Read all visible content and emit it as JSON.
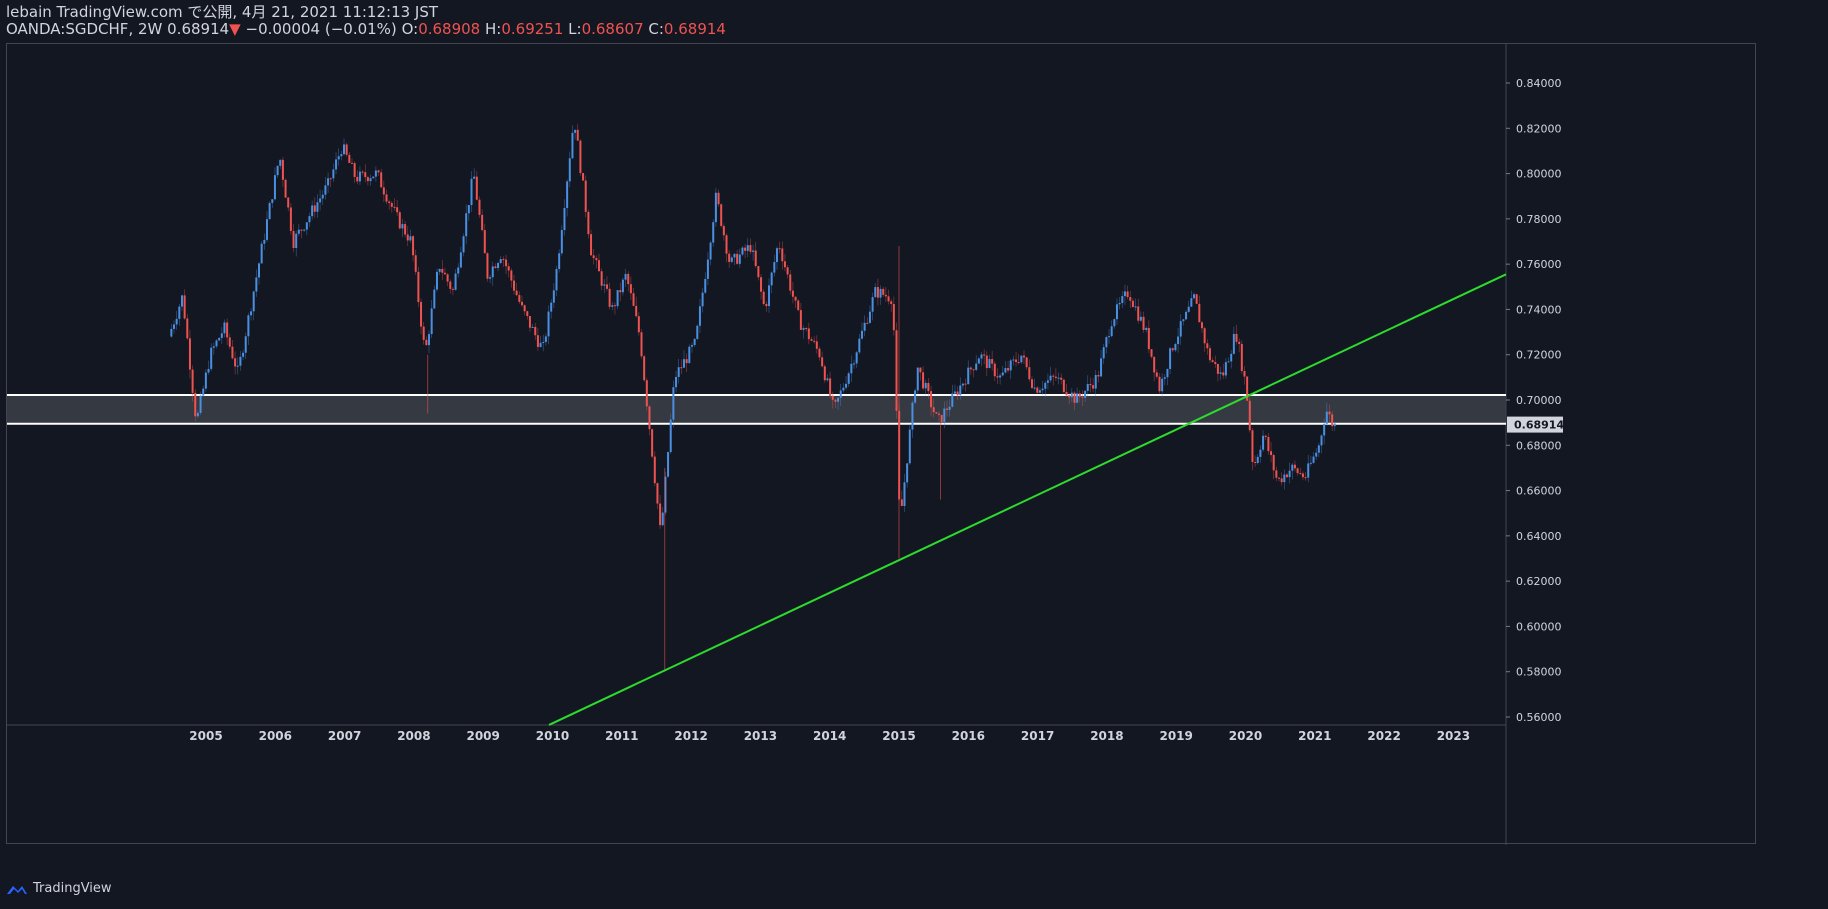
{
  "header": {
    "published_line": "lebain TradingView.com で公開, 4月 21, 2021 11:12:13 JST",
    "symbol_interval": "OANDA:SGDCHF, 2W",
    "last_price": "0.68914",
    "change_arrow": "▼",
    "change": "−0.00004 (−0.01%)",
    "o_label": "O:",
    "o_value": "0.68908",
    "h_label": "H:",
    "h_value": "0.69251",
    "l_label": "L:",
    "l_value": "0.68607",
    "c_label": "C:",
    "c_value": "0.68914"
  },
  "footer": {
    "brand": "TradingView",
    "logo_icon": "tradingview-logo-icon"
  },
  "chart_data": {
    "type": "candlestick",
    "interval": "2W",
    "symbol": "OANDA:SGDCHF",
    "xlim": [
      2004.0,
      2023.8
    ],
    "ylim": [
      0.555,
      0.858
    ],
    "y_ticks": [
      "0.56000",
      "0.58000",
      "0.60000",
      "0.62000",
      "0.64000",
      "0.66000",
      "0.68000",
      "0.70000",
      "0.72000",
      "0.74000",
      "0.76000",
      "0.78000",
      "0.80000",
      "0.82000",
      "0.84000"
    ],
    "x_ticks": [
      "2005",
      "2006",
      "2007",
      "2008",
      "2009",
      "2010",
      "2011",
      "2012",
      "2013",
      "2014",
      "2015",
      "2016",
      "2017",
      "2018",
      "2019",
      "2020",
      "2021",
      "2022",
      "2023"
    ],
    "current_price_label": "0.68914",
    "colors": {
      "background": "#131722",
      "up": "#4a90e2",
      "down": "#ef5350",
      "trendline": "#2cdc2c",
      "zone_fill": "#3a3d46",
      "zone_line": "#ffffff",
      "grid_text": "#d1d4dc"
    },
    "series": [
      {
        "name": "SGDCHF",
        "price_path": [
          [
            2004.5,
            0.728
          ],
          [
            2004.7,
            0.746
          ],
          [
            2004.9,
            0.69
          ],
          [
            2005.1,
            0.72
          ],
          [
            2005.3,
            0.732
          ],
          [
            2005.5,
            0.712
          ],
          [
            2005.8,
            0.76
          ],
          [
            2006.1,
            0.808
          ],
          [
            2006.3,
            0.77
          ],
          [
            2006.5,
            0.78
          ],
          [
            2006.8,
            0.795
          ],
          [
            2007.0,
            0.812
          ],
          [
            2007.2,
            0.798
          ],
          [
            2007.5,
            0.8
          ],
          [
            2007.8,
            0.78
          ],
          [
            2008.0,
            0.77
          ],
          [
            2008.2,
            0.72
          ],
          [
            2008.4,
            0.76
          ],
          [
            2008.6,
            0.748
          ],
          [
            2008.9,
            0.8
          ],
          [
            2009.1,
            0.755
          ],
          [
            2009.3,
            0.765
          ],
          [
            2009.6,
            0.74
          ],
          [
            2009.9,
            0.722
          ],
          [
            2010.1,
            0.758
          ],
          [
            2010.35,
            0.825
          ],
          [
            2010.6,
            0.765
          ],
          [
            2010.9,
            0.74
          ],
          [
            2011.1,
            0.755
          ],
          [
            2011.3,
            0.728
          ],
          [
            2011.5,
            0.67
          ],
          [
            2011.6,
            0.64
          ],
          [
            2011.8,
            0.71
          ],
          [
            2012.1,
            0.725
          ],
          [
            2012.4,
            0.79
          ],
          [
            2012.6,
            0.76
          ],
          [
            2012.9,
            0.768
          ],
          [
            2013.1,
            0.74
          ],
          [
            2013.3,
            0.77
          ],
          [
            2013.6,
            0.735
          ],
          [
            2013.9,
            0.72
          ],
          [
            2014.1,
            0.695
          ],
          [
            2014.4,
            0.72
          ],
          [
            2014.7,
            0.748
          ],
          [
            2014.95,
            0.745
          ],
          [
            2015.05,
            0.645
          ],
          [
            2015.3,
            0.715
          ],
          [
            2015.6,
            0.69
          ],
          [
            2015.9,
            0.705
          ],
          [
            2016.2,
            0.72
          ],
          [
            2016.5,
            0.71
          ],
          [
            2016.8,
            0.72
          ],
          [
            2017.0,
            0.705
          ],
          [
            2017.3,
            0.71
          ],
          [
            2017.6,
            0.7
          ],
          [
            2017.9,
            0.71
          ],
          [
            2018.1,
            0.735
          ],
          [
            2018.35,
            0.748
          ],
          [
            2018.6,
            0.73
          ],
          [
            2018.8,
            0.705
          ],
          [
            2019.0,
            0.725
          ],
          [
            2019.3,
            0.745
          ],
          [
            2019.5,
            0.72
          ],
          [
            2019.7,
            0.71
          ],
          [
            2019.9,
            0.73
          ],
          [
            2020.05,
            0.705
          ],
          [
            2020.15,
            0.67
          ],
          [
            2020.3,
            0.685
          ],
          [
            2020.5,
            0.664
          ],
          [
            2020.7,
            0.67
          ],
          [
            2020.9,
            0.666
          ],
          [
            2021.1,
            0.68
          ],
          [
            2021.2,
            0.696
          ],
          [
            2021.3,
            0.689
          ]
        ]
      }
    ],
    "annotations": [
      {
        "type": "horizontal_zone",
        "y_top": 0.7022,
        "y_bottom": 0.6895,
        "label": "support/resistance zone"
      },
      {
        "type": "trendline",
        "from": [
          2009.95,
          0.5565
        ],
        "to": [
          2023.8,
          0.7555
        ]
      }
    ]
  }
}
